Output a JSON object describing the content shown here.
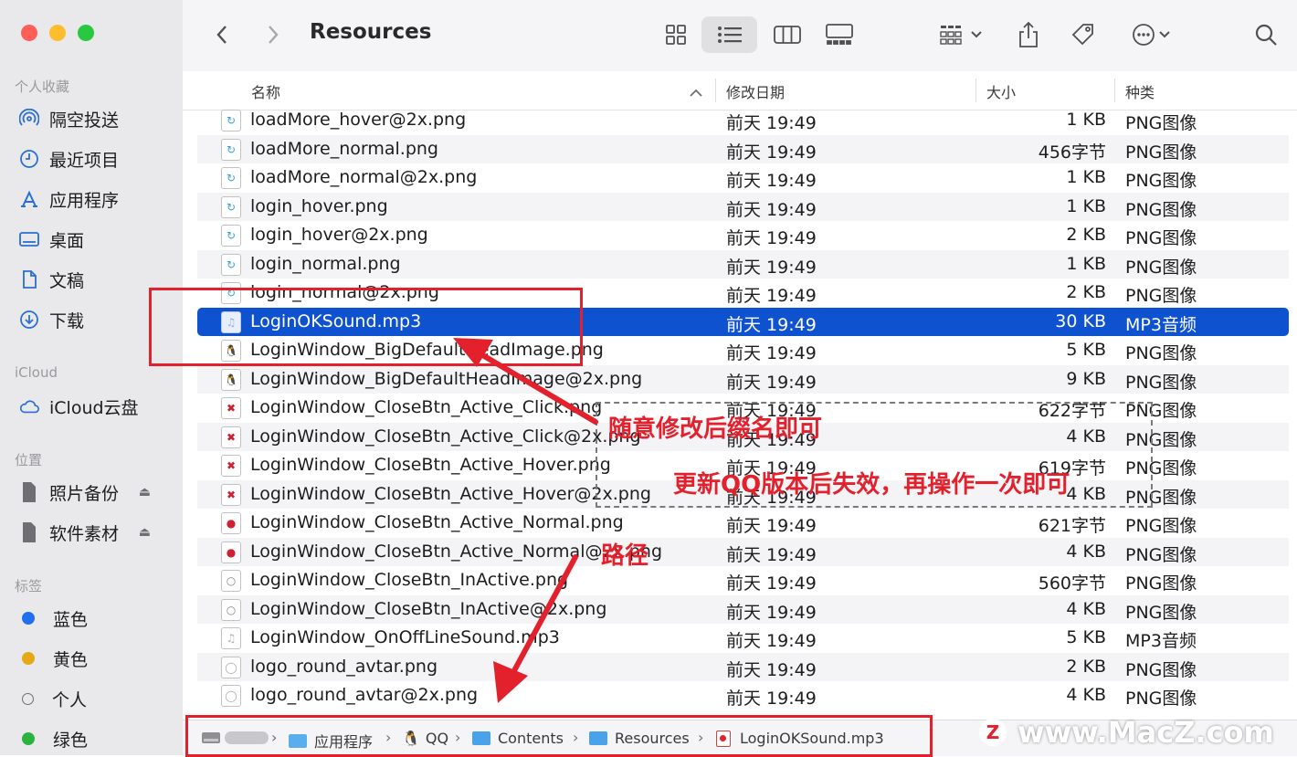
{
  "window": {
    "title": "Resources"
  },
  "sidebar": {
    "favorites_title": "个人收藏",
    "favorites": [
      "隔空投送",
      "最近项目",
      "应用程序",
      "桌面",
      "文稿",
      "下载"
    ],
    "icloud_title": "iCloud",
    "icloud": [
      "iCloud云盘"
    ],
    "locations_title": "位置",
    "locations": [
      "照片备份",
      "软件素材"
    ],
    "tags_title": "标签",
    "tags": [
      {
        "label": "蓝色",
        "color": "#1f6ff0"
      },
      {
        "label": "黄色",
        "color": "#e6a817"
      },
      {
        "label": "个人",
        "color": ""
      },
      {
        "label": "绿色",
        "color": "#2ab33d"
      }
    ]
  },
  "columns": {
    "name": "名称",
    "date": "修改日期",
    "size": "大小",
    "kind": "种类"
  },
  "files": [
    {
      "name": "loadMore_hover@2x.png",
      "date": "前天 19:49",
      "size": "1 KB",
      "kind": "PNG图像",
      "icon": "refresh-icon"
    },
    {
      "name": "loadMore_normal.png",
      "date": "前天 19:49",
      "size": "456字节",
      "kind": "PNG图像",
      "icon": "refresh-icon"
    },
    {
      "name": "loadMore_normal@2x.png",
      "date": "前天 19:49",
      "size": "1 KB",
      "kind": "PNG图像",
      "icon": "refresh-icon"
    },
    {
      "name": "login_hover.png",
      "date": "前天 19:49",
      "size": "1 KB",
      "kind": "PNG图像",
      "icon": "refresh-icon"
    },
    {
      "name": "login_hover@2x.png",
      "date": "前天 19:49",
      "size": "2 KB",
      "kind": "PNG图像",
      "icon": "refresh-icon"
    },
    {
      "name": "login_normal.png",
      "date": "前天 19:49",
      "size": "1 KB",
      "kind": "PNG图像",
      "icon": "refresh-icon"
    },
    {
      "name": "login_normal@2x.png",
      "date": "前天 19:49",
      "size": "2 KB",
      "kind": "PNG图像",
      "icon": "refresh-icon"
    },
    {
      "name": "LoginOKSound.mp3",
      "date": "前天 19:49",
      "size": "30 KB",
      "kind": "MP3音频",
      "icon": "music-note-icon"
    },
    {
      "name": "LoginWindow_BigDefaultHeadImage.png",
      "date": "前天 19:49",
      "size": "5 KB",
      "kind": "PNG图像",
      "icon": "penguin-icon"
    },
    {
      "name": "LoginWindow_BigDefaultHeadImage@2x.png",
      "date": "前天 19:49",
      "size": "9 KB",
      "kind": "PNG图像",
      "icon": "penguin-icon"
    },
    {
      "name": "LoginWindow_CloseBtn_Active_Click.png",
      "date": "前天 19:49",
      "size": "622字节",
      "kind": "PNG图像",
      "icon": "close-red-icon"
    },
    {
      "name": "LoginWindow_CloseBtn_Active_Click@2x.png",
      "date": "前天 19:49",
      "size": "4 KB",
      "kind": "PNG图像",
      "icon": "close-red-icon"
    },
    {
      "name": "LoginWindow_CloseBtn_Active_Hover.png",
      "date": "前天 19:49",
      "size": "619字节",
      "kind": "PNG图像",
      "icon": "close-red-icon"
    },
    {
      "name": "LoginWindow_CloseBtn_Active_Hover@2x.png",
      "date": "前天 19:49",
      "size": "4 KB",
      "kind": "PNG图像",
      "icon": "close-red-icon"
    },
    {
      "name": "LoginWindow_CloseBtn_Active_Normal.png",
      "date": "前天 19:49",
      "size": "621字节",
      "kind": "PNG图像",
      "icon": "red-circle-icon"
    },
    {
      "name": "LoginWindow_CloseBtn_Active_Normal@2x.png",
      "date": "前天 19:49",
      "size": "4 KB",
      "kind": "PNG图像",
      "icon": "red-circle-icon"
    },
    {
      "name": "LoginWindow_CloseBtn_InActive.png",
      "date": "前天 19:49",
      "size": "560字节",
      "kind": "PNG图像",
      "icon": "gray-circle-icon"
    },
    {
      "name": "LoginWindow_CloseBtn_InActive@2x.png",
      "date": "前天 19:49",
      "size": "4 KB",
      "kind": "PNG图像",
      "icon": "gray-circle-icon"
    },
    {
      "name": "LoginWindow_OnOffLineSound.mp3",
      "date": "前天 19:49",
      "size": "5 KB",
      "kind": "MP3音频",
      "icon": "music-note-icon"
    },
    {
      "name": "logo_round_avtar.png",
      "date": "前天 19:49",
      "size": "2 KB",
      "kind": "PNG图像",
      "icon": "avatar-icon"
    },
    {
      "name": "logo_round_avtar@2x.png",
      "date": "前天 19:49",
      "size": "4 KB",
      "kind": "PNG图像",
      "icon": "avatar-icon"
    }
  ],
  "selected_index": 7,
  "pathbar": {
    "items": [
      "应用程序",
      "QQ",
      "Contents",
      "Resources",
      "LoginOKSound.mp3"
    ]
  },
  "annotations": {
    "rename_hint": "随意修改后缀名即可",
    "update_hint": "更新QQ版本后失效，再操作一次即可",
    "path_hint": "路径",
    "color": "#e3212d"
  },
  "watermark": {
    "letter": "Z",
    "text": "www.MacZ.com"
  },
  "colors": {
    "selection": "#0e52d0",
    "sidebar_bg": "#e9e9eb",
    "accent": "#2a6ed6"
  }
}
